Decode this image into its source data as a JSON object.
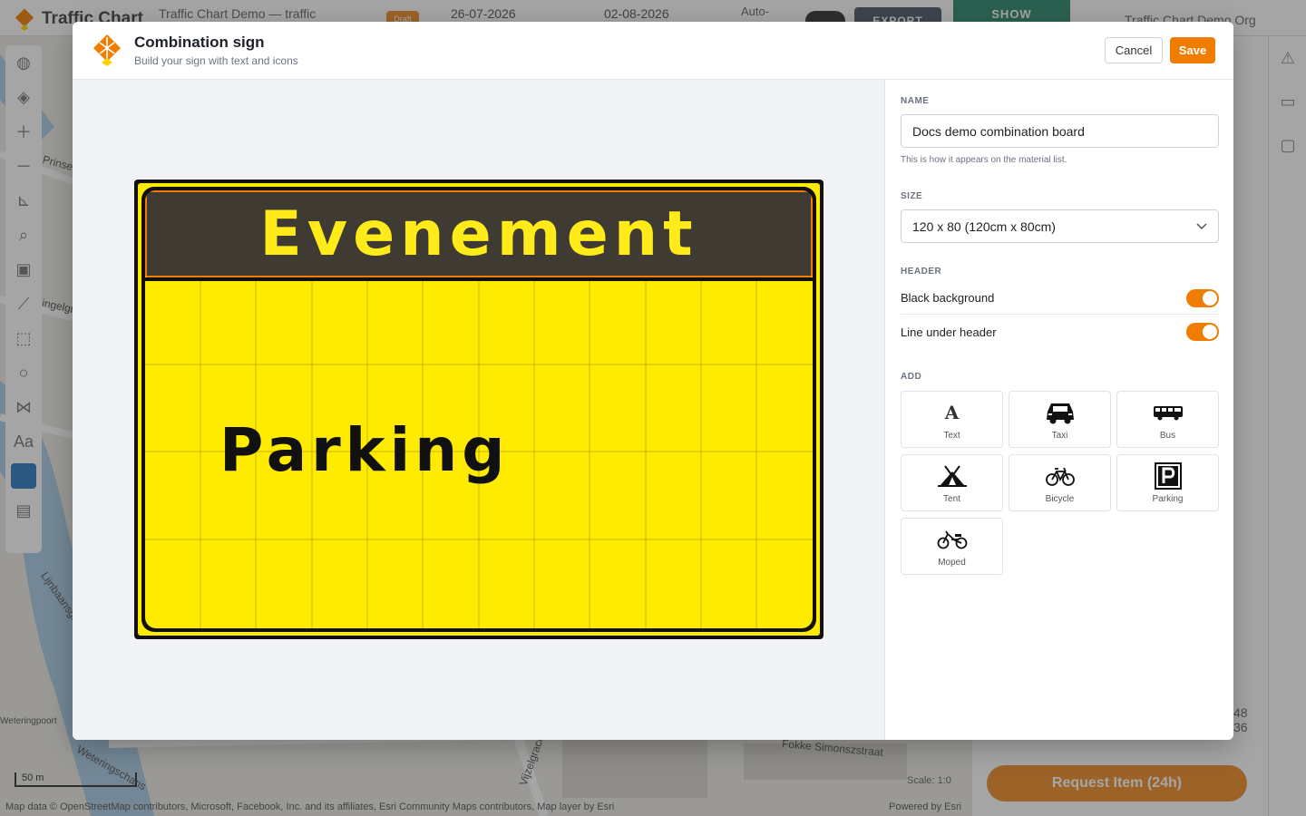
{
  "app": {
    "brand": "Traffic Chart",
    "project_title": "Traffic Chart Demo — traffic",
    "badge": "Draft",
    "date_start": "26-07-2026",
    "date_end": "02-08-2026",
    "auto_label": "Auto-",
    "export_label": "EXPORT",
    "show_label": "SHOW",
    "org": "Traffic Chart Demo Org",
    "request_button": "Request Item (24h)",
    "side_numbers": [
      "48",
      "36"
    ],
    "map_attribution": "Map data © OpenStreetMap contributors, Microsoft, Facebook, Inc. and its affiliates, Esri Community Maps contributors, Map layer by Esri",
    "powered_by": "Powered by Esri",
    "scale_label": "50 m",
    "scale_value": "Scale: 1:0",
    "street_labels": [
      "Prinsengracht",
      "Singelgracht",
      "Weteringschans",
      "Fokke Simonszstraat",
      "Vijzelgracht",
      "Lijnbaansgracht",
      "Weteringpoort"
    ],
    "colors": {
      "accent": "#f07d00",
      "sign_yellow": "#ffeb00",
      "header_bg": "#3f3a32",
      "header_text": "#ffeb1a"
    }
  },
  "modal": {
    "title": "Combination sign",
    "subtitle": "Build your sign with text and icons",
    "cancel_label": "Cancel",
    "save_label": "Save"
  },
  "sign": {
    "header_text": "Evenement",
    "body_text": "Parking",
    "header_black_background": true,
    "line_under_header": true
  },
  "form": {
    "name_label": "NAME",
    "name_value": "Docs demo combination board",
    "name_hint": "This is how it appears on the material list.",
    "size_label": "SIZE",
    "size_value": "120 x 80 (120cm x 80cm)",
    "header_label": "HEADER",
    "toggle_black_bg": "Black background",
    "toggle_line": "Line under header",
    "add_label": "ADD",
    "add_items": [
      {
        "label": "Text",
        "icon": "text-icon"
      },
      {
        "label": "Taxi",
        "icon": "taxi-icon"
      },
      {
        "label": "Bus",
        "icon": "bus-icon"
      },
      {
        "label": "Tent",
        "icon": "tent-icon"
      },
      {
        "label": "Bicycle",
        "icon": "bicycle-icon"
      },
      {
        "label": "Parking",
        "icon": "parking-icon"
      },
      {
        "label": "Moped",
        "icon": "moped-icon"
      }
    ]
  }
}
